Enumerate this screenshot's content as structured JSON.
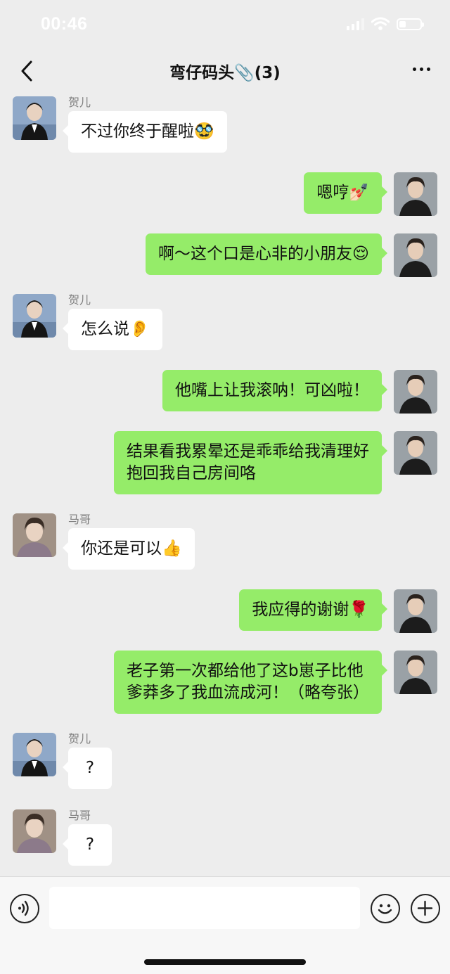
{
  "status_bar": {
    "time": "00:46"
  },
  "header": {
    "title": "弯仔码头📎(3)"
  },
  "messages": [
    {
      "sender": "贺儿",
      "text": "不过你终于醒啦🥸"
    },
    {
      "text": "嗯哼💅🏻"
    },
    {
      "text": "啊～这个口是心非的小朋友😌"
    },
    {
      "sender": "贺儿",
      "text": "怎么说👂"
    },
    {
      "text": "他嘴上让我滚呐！可凶啦！"
    },
    {
      "text": "结果看我累晕还是乖乖给我清理好\n抱回我自己房间咯"
    },
    {
      "sender": "马哥",
      "text": "你还是可以👍"
    },
    {
      "text": "我应得的谢谢🌹"
    },
    {
      "text": "老子第一次都给他了这b崽子比他\n爹莽多了我血流成河！（略夸张）"
    },
    {
      "sender": "贺儿",
      "text": "?"
    },
    {
      "sender": "马哥",
      "text": "?"
    }
  ],
  "input_bar": {
    "value": ""
  }
}
